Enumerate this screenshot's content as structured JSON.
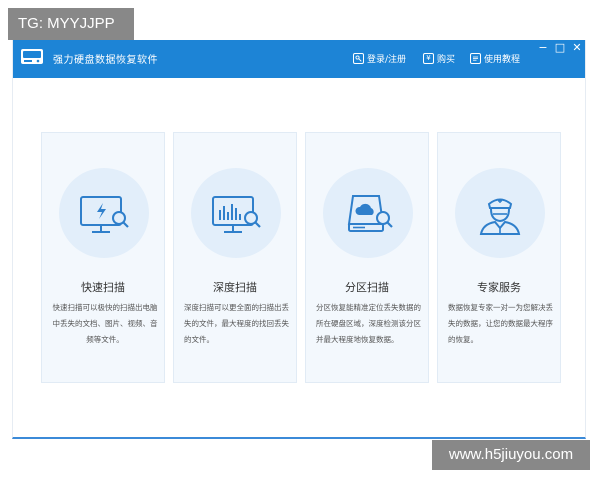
{
  "watermarks": {
    "top_left": "TG: MYYJJPP",
    "bottom_right": "www.h5jiuyou.com"
  },
  "app": {
    "title": "强力硬盘数据恢复软件",
    "toolbar": {
      "login_label": "登录/注册",
      "buy_label": "购买",
      "tutorial_label": "使用教程"
    },
    "window_controls": {
      "minimize": "−",
      "maximize": "□",
      "close": "✕"
    }
  },
  "cards": [
    {
      "icon": "monitor-lightning-search-icon",
      "title": "快速扫描",
      "description": "快速扫描可以极快的扫描出电脑中丢失的文档、图片、视频、音频等文件。"
    },
    {
      "icon": "monitor-chart-search-icon",
      "title": "深度扫描",
      "description": "深度扫描可以更全面的扫描出丢失的文件，最大程度的找回丢失的文件。"
    },
    {
      "icon": "disk-cloud-search-icon",
      "title": "分区扫描",
      "description": "分区恢复能精准定位丢失数据的所在硬盘区域，深度检测该分区并最大程度地恢复数据。"
    },
    {
      "icon": "expert-doctor-icon",
      "title": "专家服务",
      "description": "数据恢复专家一对一为您解决丢失的数据，让您的数据最大程序的恢复。"
    }
  ],
  "colors": {
    "titlebar": "#1d84d6",
    "card_bg": "#f3f8fd",
    "icon_circle": "#e2eefa",
    "icon_stroke": "#2f7fcb"
  }
}
